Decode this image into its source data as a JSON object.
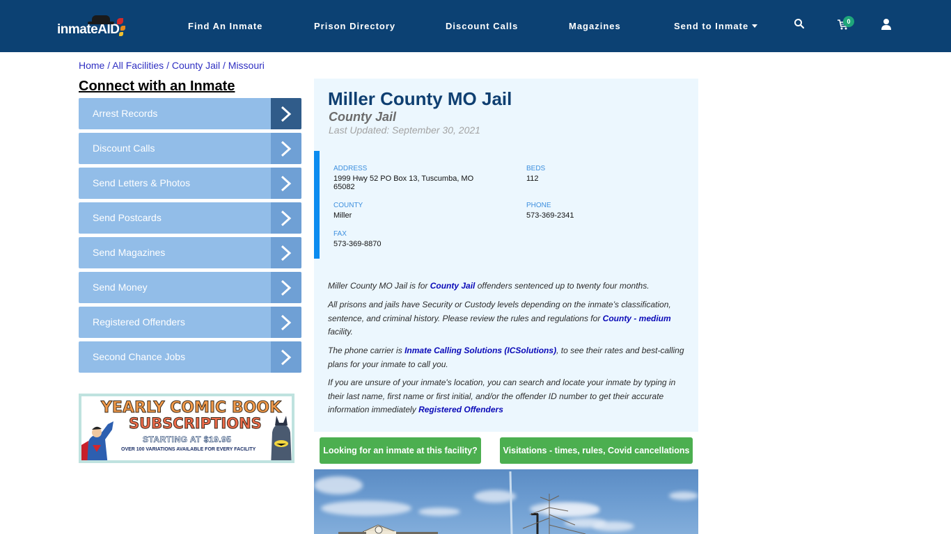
{
  "header": {
    "logo_text": "inmateAID",
    "nav": [
      {
        "label": "Find An Inmate"
      },
      {
        "label": "Prison Directory"
      },
      {
        "label": "Discount Calls"
      },
      {
        "label": "Magazines"
      },
      {
        "label": "Send to Inmate",
        "has_dropdown": true
      }
    ],
    "icons": {
      "search": "search-icon",
      "cart": "cart-icon",
      "user": "user-icon"
    },
    "cart_count": "0"
  },
  "breadcrumb": [
    {
      "label": "Home"
    },
    {
      "label": "All Facilities"
    },
    {
      "label": "County Jail"
    },
    {
      "label": "Missouri"
    }
  ],
  "breadcrumb_separator": "/",
  "sidebar": {
    "title": "Connect with an Inmate",
    "items": [
      {
        "label": "Arrest Records"
      },
      {
        "label": "Discount Calls"
      },
      {
        "label": "Send Letters & Photos"
      },
      {
        "label": "Send Postcards"
      },
      {
        "label": "Send Magazines"
      },
      {
        "label": "Send Money"
      },
      {
        "label": "Registered Offenders"
      },
      {
        "label": "Second Chance Jobs"
      }
    ],
    "ad": {
      "line1": "YEARLY COMIC BOOK",
      "line2": "SUBSCRIPTIONS",
      "line3": "STARTING AT $19.95",
      "line4": "OVER 100 VARIATIONS AVAILABLE FOR EVERY FACILITY"
    }
  },
  "facility": {
    "name": "Miller County MO Jail",
    "type": "County Jail",
    "last_updated": "Last Updated: September 30, 2021",
    "info": {
      "address_label": "ADDRESS",
      "address_line1": "1999 Hwy 52 PO Box 13, Tuscumba, MO",
      "address_line2": "65082",
      "beds_label": "BEDS",
      "beds": "112",
      "county_label": "COUNTY",
      "county": "Miller",
      "phone_label": "PHONE",
      "phone": "573-369-2341",
      "fax_label": "FAX",
      "fax": "573-369-8870"
    },
    "description": {
      "p1_pre": "Miller County MO Jail is for ",
      "p1_link": "County Jail",
      "p1_post": " offenders sentenced up to twenty four months.",
      "p2_pre": "All prisons and jails have Security or Custody levels depending on the inmate’s classification, sentence, and criminal history. Please review the rules and regulations for ",
      "p2_link": "County - medium",
      "p2_post": " facility.",
      "p3_pre": "The phone carrier is ",
      "p3_link": "Inmate Calling Solutions (ICSolutions)",
      "p3_post": ", to see their rates and best-calling plans for your inmate to call you.",
      "p4_pre": "If you are unsure of your inmate's location, you can search and locate your inmate by typing in their last name, first name or first initial, and/or the offender ID number to get their accurate information immediately ",
      "p4_link": "Registered Offenders"
    }
  },
  "actions": {
    "find_inmate": "Looking for an inmate at this facility?",
    "visitations": "Visitations - times, rules, Covid cancellations"
  },
  "colors": {
    "navbar": "#0c4173",
    "sidebar_item": "#92bde8",
    "link": "#0a0ab8",
    "green_button": "#4caf50",
    "info_accent": "#0c8cf0"
  }
}
